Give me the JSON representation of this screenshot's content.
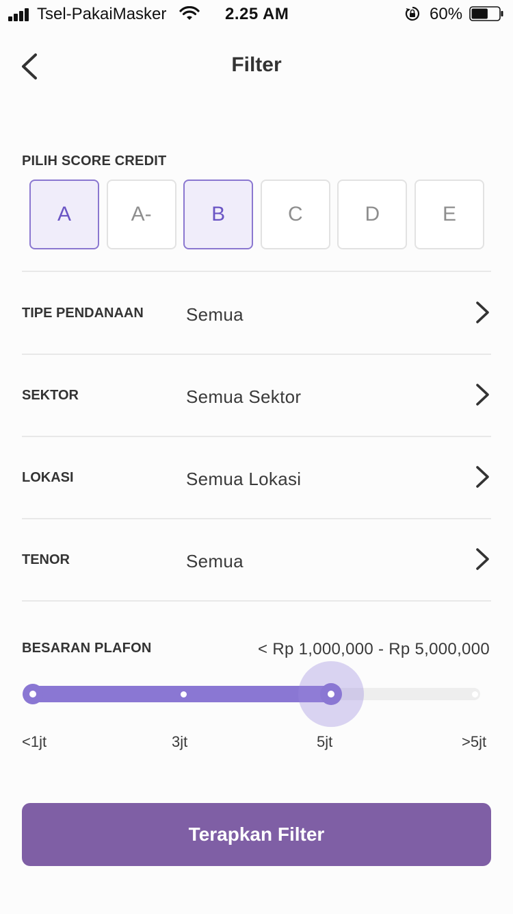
{
  "status_bar": {
    "carrier": "Tsel-PakaiMasker",
    "time": "2.25 AM",
    "battery_percent": "60%",
    "battery_level": 0.6
  },
  "nav": {
    "title": "Filter",
    "back_icon": "chevron-left-icon"
  },
  "credit_score": {
    "label": "PILIH SCORE CREDIT",
    "grades": [
      {
        "label": "A",
        "selected": true
      },
      {
        "label": "A-",
        "selected": false
      },
      {
        "label": "B",
        "selected": true
      },
      {
        "label": "C",
        "selected": false
      },
      {
        "label": "D",
        "selected": false
      },
      {
        "label": "E",
        "selected": false
      }
    ]
  },
  "filters": [
    {
      "label": "TIPE PENDANAAN",
      "value": "Semua"
    },
    {
      "label": "SEKTOR",
      "value": "Semua Sektor"
    },
    {
      "label": "LOKASI",
      "value": "Semua Lokasi"
    },
    {
      "label": "TENOR",
      "value": "Semua"
    }
  ],
  "plafon": {
    "label": "BESARAN PLAFON",
    "range_text": "< Rp 1,000,000 - Rp 5,000,000",
    "stops": [
      "<1jt",
      "3jt",
      "5jt",
      ">5jt"
    ],
    "selected_from_index": 0,
    "selected_to_index": 2
  },
  "apply_button": {
    "label": "Terapkan Filter"
  },
  "colors": {
    "accent": "#8a77d3",
    "selected_text": "#6a55c4",
    "button": "#7f5fa5"
  }
}
